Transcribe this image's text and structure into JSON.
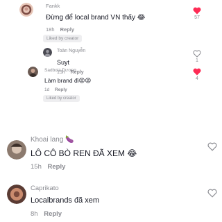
{
  "colors": {
    "liked": "#fe2c55",
    "muted": "#8a8b91",
    "text": "#161823"
  },
  "comments": [
    {
      "author": "Fankk",
      "text": "Đừng để local brand VN thấy 😂",
      "time": "18h",
      "reply_label": "Reply",
      "badge": "Liked by creator",
      "likes": "57",
      "liked": true
    },
    {
      "author": "Toàn Nguyễn",
      "text": "Suyt",
      "time": "15h",
      "reply_label": "Reply",
      "likes": "1",
      "liked": false
    },
    {
      "author": "Sadboiz Dương",
      "text": "Làm brand đi😡😡",
      "time": "1d",
      "reply_label": "Reply",
      "badge": "Liked by creator",
      "likes": "4",
      "liked": true
    },
    {
      "author": "Khoai lang 🍆",
      "text": "LÔ CÔ BÒ REN ĐÃ XEM 😂",
      "time": "15h",
      "reply_label": "Reply",
      "liked": false
    },
    {
      "author": "Caprikato",
      "text": "Localbrands đã xem",
      "time": "8h",
      "reply_label": "Reply",
      "liked": false
    }
  ]
}
